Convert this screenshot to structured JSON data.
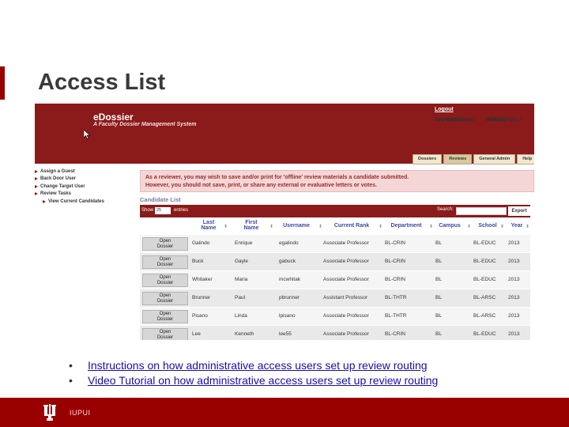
{
  "slide": {
    "title": "Access List",
    "links": [
      "Instructions on how administrative access users set up review routing",
      "Video Tutorial on how administrative access users set up review routing"
    ],
    "footer_text": "IUPUI",
    "accent_color": "#990000"
  },
  "app": {
    "name": "eDossier",
    "subtitle": "A Faculty Dossier Management System",
    "logout": "Logout",
    "user_info": [
      {
        "label": "Employee Name:",
        "value": "Massey, Anne P."
      },
      {
        "label": "Employee ID:",
        "value": "0001756722"
      },
      {
        "label": "User Name:",
        "value": "amassey"
      },
      {
        "label": "User Department:",
        "value": "BL-BUS"
      }
    ],
    "tabs": [
      "Dossiers",
      "Reviews",
      "General Admin",
      "Help"
    ],
    "active_tab": "Reviews",
    "sidebar": [
      "Assign a Guest",
      "Back Door User",
      "Change Target User",
      "Review Tasks",
      "View Current Candidates"
    ],
    "notice_line1": "As a reviewer, you may wish to save and/or print for 'offline' review materials a candidate submitted.",
    "notice_line2": "However, you should not save, print, or share any external or evaluative letters or votes.",
    "section_title": "Candidate List",
    "toolbar": {
      "show": "Show",
      "page_size": "25",
      "entries": "entries",
      "search": "Search:",
      "export": "Export"
    },
    "columns": [
      "Last Name",
      "First Name",
      "Username",
      "Current Rank",
      "Department",
      "Campus",
      "School",
      "Year"
    ],
    "open_label": "Open Dossier",
    "rows": [
      {
        "last": "Galindo",
        "first": "Enrique",
        "user": "egalindo",
        "rank": "Associate Professor",
        "dept": "BL-CRIN",
        "campus": "BL",
        "school": "BL-EDUC",
        "year": "2013"
      },
      {
        "last": "Buck",
        "first": "Gayle",
        "user": "gabuck",
        "rank": "Associate Professor",
        "dept": "BL-CRIN",
        "campus": "BL",
        "school": "BL-EDUC",
        "year": "2013"
      },
      {
        "last": "Whitaker",
        "first": "Maria",
        "user": "mcwhitak",
        "rank": "Associate Professor",
        "dept": "BL-CRIN",
        "campus": "BL",
        "school": "BL-EDUC",
        "year": "2013"
      },
      {
        "last": "Brunner",
        "first": "Paul",
        "user": "pbrunner",
        "rank": "Assistant Professor",
        "dept": "BL-THTR",
        "campus": "BL",
        "school": "BL-ARSC",
        "year": "2013"
      },
      {
        "last": "Pisano",
        "first": "Linda",
        "user": "lpisano",
        "rank": "Associate Professor",
        "dept": "BL-THTR",
        "campus": "BL",
        "school": "BL-ARSC",
        "year": "2013"
      },
      {
        "last": "Lee",
        "first": "Kenneth",
        "user": "lee55",
        "rank": "Associate Professor",
        "dept": "BL-CRIN",
        "campus": "BL",
        "school": "BL-EDUC",
        "year": "2013"
      }
    ]
  }
}
